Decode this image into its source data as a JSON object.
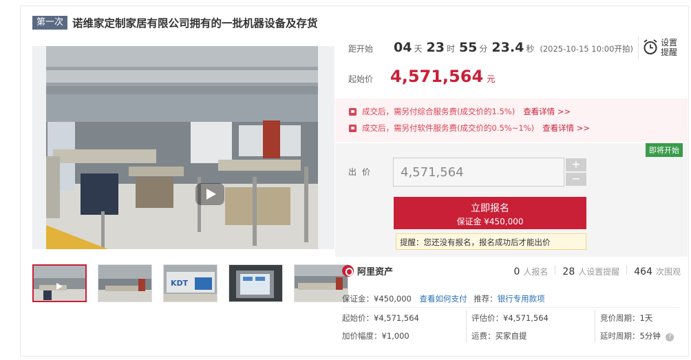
{
  "title": {
    "round_badge": "第一次",
    "text": "诺维家定制家居有限公司拥有的一批机器设备及存货"
  },
  "countdown": {
    "label": "距开始",
    "days": "04",
    "days_unit": "天",
    "hours": "23",
    "hours_unit": "时",
    "minutes": "55",
    "minutes_unit": "分",
    "seconds": "23.4",
    "seconds_unit": "秒",
    "start_note": "(2025-10-15 10:00开拍)"
  },
  "reminder": {
    "line1": "设置",
    "line2": "提醒",
    "icon": "alarm-clock-icon"
  },
  "start_price": {
    "label": "起始价",
    "value": "4,571,564",
    "unit": "元"
  },
  "fees": [
    {
      "text": "成交后，需另付综合服务费(成交价的1.5%)",
      "link": "查看详情 >>"
    },
    {
      "text": "成交后，需另付软件服务费(成交价的0.5%~1%)",
      "link": "查看详情 >>"
    }
  ],
  "bid": {
    "status_badge": "即将开始",
    "label": "出价",
    "input_value": "4,571,564",
    "plus": "+",
    "minus": "−",
    "signup_label": "立即报名",
    "deposit_label": "保证金 ¥450,000",
    "tip": "提醒：您还没有报名，报名成功后才能出价"
  },
  "platform": {
    "name": "阿里资产"
  },
  "stats": [
    {
      "n": "0",
      "label": "人报名"
    },
    {
      "n": "28",
      "label": "人设置提醒"
    },
    {
      "n": "464",
      "label": "次围观"
    }
  ],
  "details": {
    "deposit_key": "保证金：",
    "deposit_val": "¥450,000",
    "how_to_pay": "查看如何支付",
    "recommend_key": "推荐：",
    "recommend_val": "银行专用款项",
    "start_price_key": "起始价：",
    "start_price_val": "¥4,571,564",
    "appraisal_key": "评估价：",
    "appraisal_val": "¥4,571,564",
    "cycle_key": "竞价周期：",
    "cycle_val": "1天",
    "increment_key": "加价幅度：",
    "increment_val": "¥1,000",
    "shipping_key": "运费：",
    "shipping_val": "买家自提",
    "delay_key": "延时周期：",
    "delay_val": "5分钟",
    "help": "?"
  },
  "colors": {
    "accent": "#c91f37",
    "badge_green": "#3a9b4b",
    "link_blue": "#2a6fb8",
    "round_badge": "#5a6a84"
  }
}
